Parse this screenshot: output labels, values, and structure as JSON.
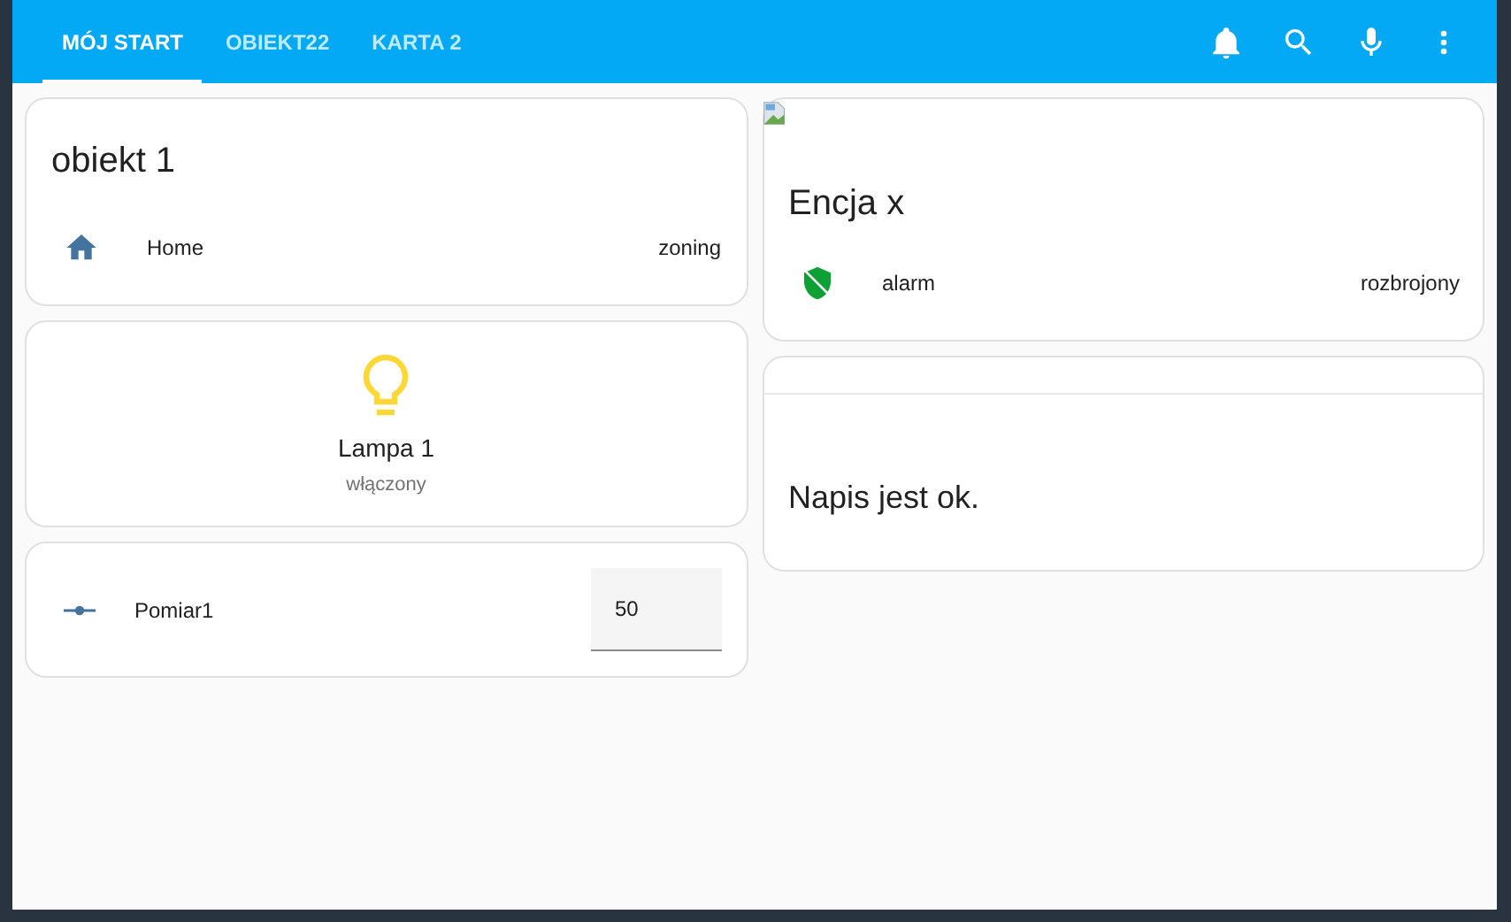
{
  "tabs": [
    {
      "label": "MÓJ START",
      "selected": true
    },
    {
      "label": "OBIEKT22",
      "selected": false
    },
    {
      "label": "KARTA 2",
      "selected": false
    }
  ],
  "left_column": [
    {
      "kind": "entities",
      "title": "obiekt 1",
      "rows": [
        {
          "name": "Home",
          "state": "zoning"
        }
      ]
    },
    {
      "kind": "button",
      "name": "Lampa 1",
      "state": "włączony",
      "on": true
    },
    {
      "kind": "input",
      "name": "Pomiar1",
      "value": "50"
    }
  ],
  "right_column": [
    {
      "kind": "picture_entities",
      "title": "Encja x",
      "rows": [
        {
          "name": "alarm",
          "state": "rozbrojony"
        }
      ]
    },
    {
      "kind": "markdown",
      "text": "Napis jest ok."
    }
  ]
}
